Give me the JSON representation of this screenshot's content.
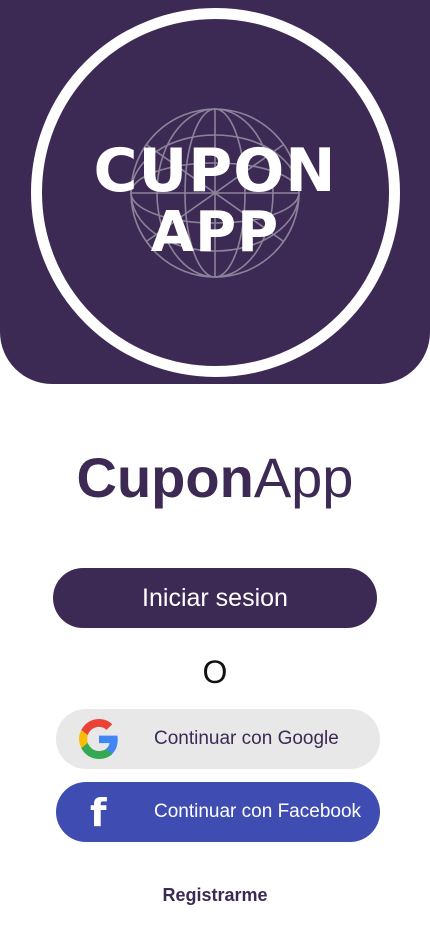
{
  "logo": {
    "line1": "CUPON",
    "line2": "APP",
    "icon": "globe-icon"
  },
  "title": {
    "bold_part": "Cupon",
    "regular_part": "App"
  },
  "actions": {
    "login_label": "Iniciar sesion",
    "or_separator": "O",
    "google_label": "Continuar con Google",
    "facebook_label": "Continuar con Facebook",
    "register_label": "Registrarme"
  },
  "colors": {
    "brand": "#3c2a55",
    "facebook": "#3f4db3",
    "google_bg": "#e8e8e8"
  }
}
